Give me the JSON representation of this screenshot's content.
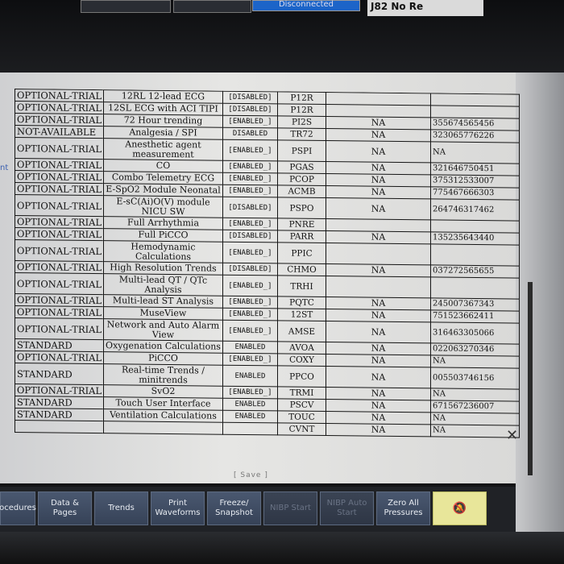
{
  "header": {
    "tab_label": "Disconnected",
    "label": "J82 No Re"
  },
  "side_note": "nt",
  "table": {
    "rows": [
      {
        "status": "OPTIONAL-TRIAL",
        "feature": "12RL 12-lead ECG",
        "enabled": "[DISABLED]",
        "code": "P12R",
        "na": "",
        "serial": ""
      },
      {
        "status": "OPTIONAL-TRIAL",
        "feature": "12SL ECG with ACI TIPI",
        "enabled": "[DISABLED]",
        "code": "P12R",
        "na": "",
        "serial": ""
      },
      {
        "status": "OPTIONAL-TRIAL",
        "feature": "72 Hour trending",
        "enabled": "[ENABLED_]",
        "code": "PI2S",
        "na": "NA",
        "serial": "355674565456"
      },
      {
        "status": "NOT-AVAILABLE",
        "feature": "Analgesia / SPI",
        "enabled": "DISABLED",
        "code": "TR72",
        "na": "NA",
        "serial": "323065776226"
      },
      {
        "status": "OPTIONAL-TRIAL",
        "feature": "Anesthetic agent measurement",
        "enabled": "[ENABLED_]",
        "code": "PSPI",
        "na": "NA",
        "serial": "NA"
      },
      {
        "status": "OPTIONAL-TRIAL",
        "feature": "CO",
        "enabled": "[ENABLED_]",
        "code": "PGAS",
        "na": "NA",
        "serial": "321646750451"
      },
      {
        "status": "OPTIONAL-TRIAL",
        "feature": "Combo Telemetry ECG",
        "enabled": "[ENABLED_]",
        "code": "PCOP",
        "na": "NA",
        "serial": "375312533007"
      },
      {
        "status": "OPTIONAL-TRIAL",
        "feature": "E-SpO2 Module Neonatal",
        "enabled": "[ENABLED_]",
        "code": "ACMB",
        "na": "NA",
        "serial": "775467666303"
      },
      {
        "status": "OPTIONAL-TRIAL",
        "feature": "E-sC(Ai)O(V) module NICU SW",
        "enabled": "[DISABLED]",
        "code": "PSPO",
        "na": "NA",
        "serial": "264746317462"
      },
      {
        "status": "OPTIONAL-TRIAL",
        "feature": "Full Arrhythmia",
        "enabled": "[ENABLED_]",
        "code": "PNRE",
        "na": "",
        "serial": ""
      },
      {
        "status": "OPTIONAL-TRIAL",
        "feature": "Full PiCCO",
        "enabled": "[DISABLED]",
        "code": "PARR",
        "na": "NA",
        "serial": "135235643440"
      },
      {
        "status": "OPTIONAL-TRIAL",
        "feature": "Hemodynamic Calculations",
        "enabled": "[ENABLED_]",
        "code": "PPIC",
        "na": "",
        "serial": ""
      },
      {
        "status": "OPTIONAL-TRIAL",
        "feature": "High Resolution Trends",
        "enabled": "[DISABLED]",
        "code": "CHMO",
        "na": "NA",
        "serial": "037272565655"
      },
      {
        "status": "OPTIONAL-TRIAL",
        "feature": "Multi-lead QT / QTc Analysis",
        "enabled": "[ENABLED_]",
        "code": "TRHI",
        "na": "",
        "serial": ""
      },
      {
        "status": "OPTIONAL-TRIAL",
        "feature": "Multi-lead ST Analysis",
        "enabled": "[ENABLED_]",
        "code": "PQTC",
        "na": "NA",
        "serial": "245007367343"
      },
      {
        "status": "OPTIONAL-TRIAL",
        "feature": "MuseView",
        "enabled": "[ENABLED_]",
        "code": "12ST",
        "na": "NA",
        "serial": "751523662411"
      },
      {
        "status": "OPTIONAL-TRIAL",
        "feature": "Network and Auto Alarm View",
        "enabled": "[ENABLED_]",
        "code": "AMSE",
        "na": "NA",
        "serial": "316463305066"
      },
      {
        "status": "STANDARD",
        "feature": "Oxygenation Calculations",
        "enabled": "ENABLED",
        "code": "AVOA",
        "na": "NA",
        "serial": "022063270346"
      },
      {
        "status": "OPTIONAL-TRIAL",
        "feature": "PiCCO",
        "enabled": "[ENABLED_]",
        "code": "COXY",
        "na": "NA",
        "serial": "NA"
      },
      {
        "status": "STANDARD",
        "feature": "Real-time Trends / minitrends",
        "enabled": "ENABLED",
        "code": "PPCO",
        "na": "NA",
        "serial": "005503746156"
      },
      {
        "status": "OPTIONAL-TRIAL",
        "feature": "SvO2",
        "enabled": "[ENABLED_]",
        "code": "TRMI",
        "na": "NA",
        "serial": "NA"
      },
      {
        "status": "STANDARD",
        "feature": "Touch User Interface",
        "enabled": "ENABLED",
        "code": "PSCV",
        "na": "NA",
        "serial": "671567236007"
      },
      {
        "status": "STANDARD",
        "feature": "Ventilation Calculations",
        "enabled": "ENABLED",
        "code": "TOUC",
        "na": "NA",
        "serial": "NA"
      },
      {
        "status": "",
        "feature": "",
        "enabled": "",
        "code": "CVNT",
        "na": "NA",
        "serial": "NA"
      }
    ]
  },
  "save_label": "[ Save ]",
  "toolbar": {
    "buttons": [
      {
        "label": "ocedures",
        "disabled": false
      },
      {
        "label": "Data & Pages",
        "disabled": false
      },
      {
        "label": "Trends",
        "disabled": false
      },
      {
        "label": "Print Waveforms",
        "disabled": false
      },
      {
        "label": "Freeze/ Snapshot",
        "disabled": false
      },
      {
        "label": "NIBP Start",
        "disabled": true
      },
      {
        "label": "NIBP Auto Start",
        "disabled": true
      },
      {
        "label": "Zero All Pressures",
        "disabled": false
      }
    ],
    "alarm_icon": "bell-off-icon"
  }
}
